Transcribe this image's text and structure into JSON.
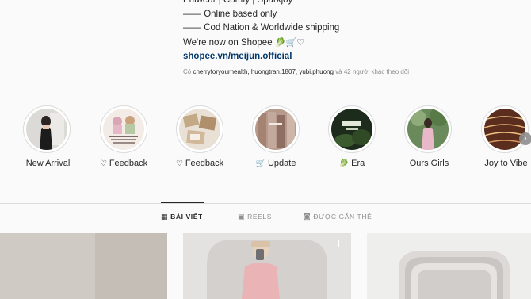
{
  "bio": {
    "line_top": "Phiwear | Comfy | Sparkjoy",
    "line1": "—— Online based only",
    "line2": "—— Cod Nation & Worldwide shipping",
    "shopee_text": "We're now on Shopee",
    "shopee_emojis": "🥬🛒♡",
    "link": "shopee.vn/meijun.official"
  },
  "followed_by": {
    "prefix": "Có",
    "users": "cherryforyourhealth, huongtran.1807, yubi.phuong",
    "suffix": "và 42 người khác theo dõi"
  },
  "highlights": [
    {
      "label": "New Arrival",
      "icon": ""
    },
    {
      "label": "Feedback",
      "icon": "♡"
    },
    {
      "label": "Feedback",
      "icon": "♡"
    },
    {
      "label": "Update",
      "icon": "🛒"
    },
    {
      "label": "Era",
      "icon": "🥬"
    },
    {
      "label": "Ours Girls",
      "icon": ""
    },
    {
      "label": "Joy to Vibe",
      "icon": ""
    }
  ],
  "next_arrow": "›",
  "tabs": [
    {
      "label": "BÀI VIẾT",
      "icon": "▦"
    },
    {
      "label": "REELS",
      "icon": "▣"
    },
    {
      "label": "ĐƯỢC GẮN THẺ",
      "icon": "◙"
    }
  ],
  "colors": {
    "background": "#fafafa",
    "text": "#262626",
    "secondary": "#8e8e8e",
    "link": "#00376b",
    "border": "#dbdbdb"
  }
}
